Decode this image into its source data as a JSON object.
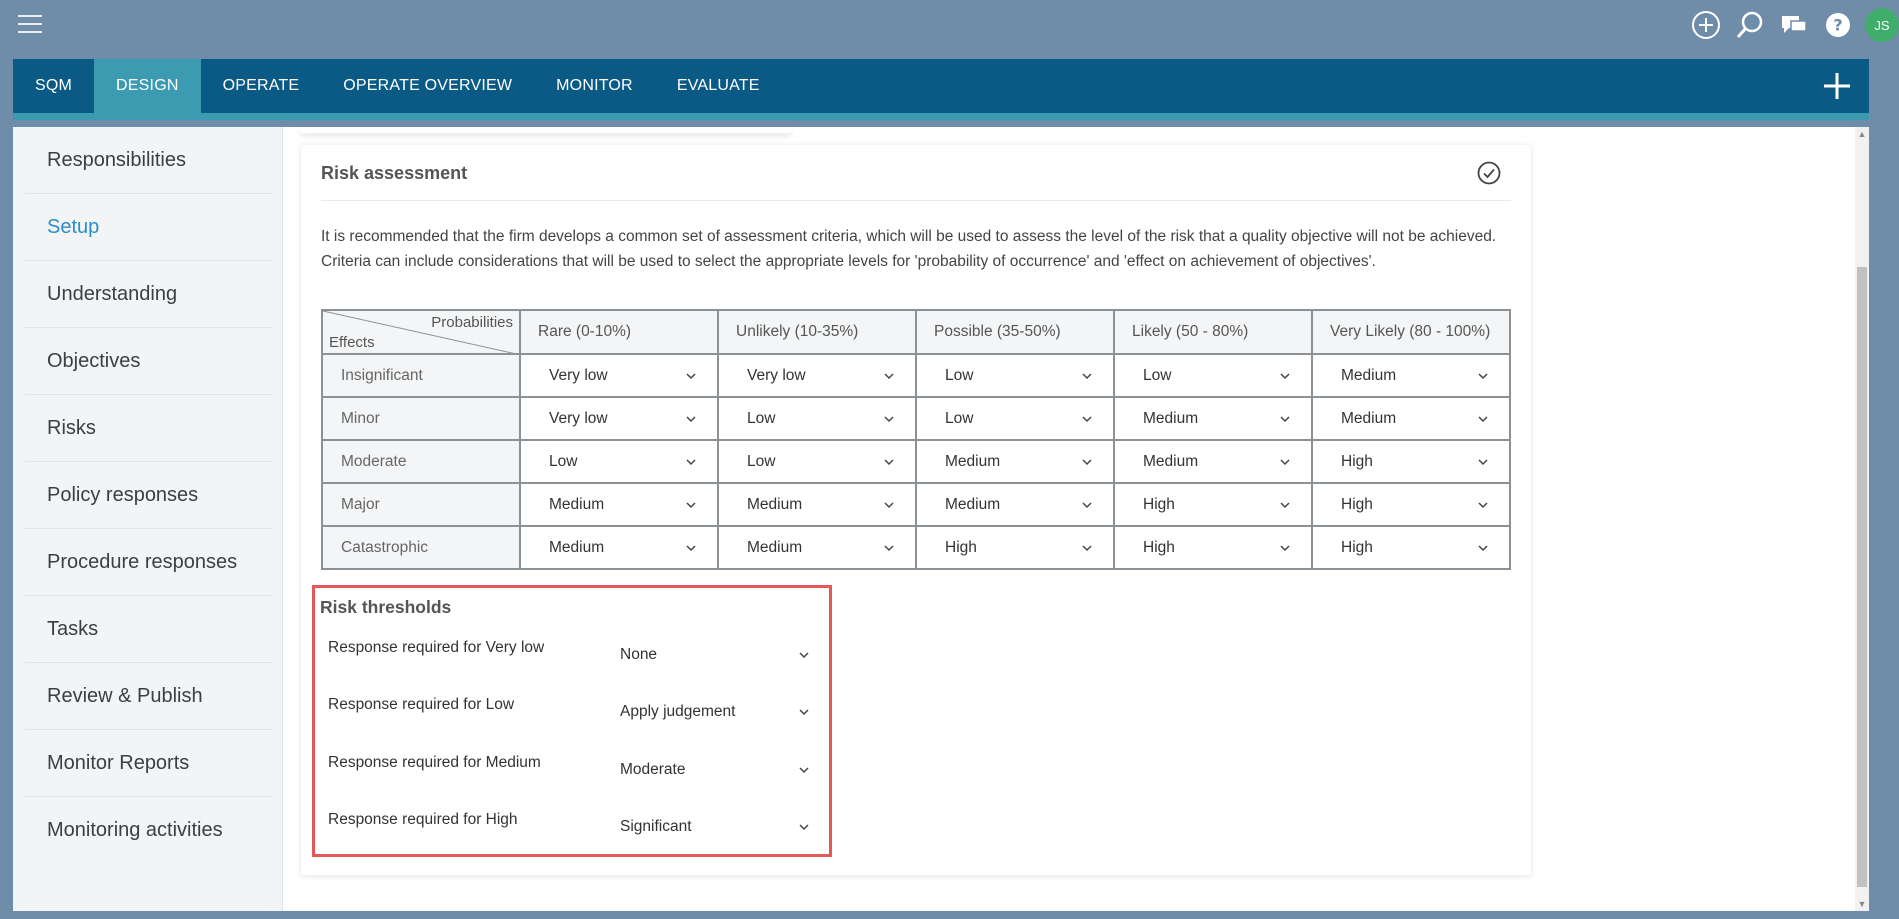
{
  "topbar": {
    "avatar_initials": "JS",
    "icons": [
      "add-circle-icon",
      "search-icon",
      "chat-icon",
      "help-icon"
    ]
  },
  "nav": {
    "tabs": [
      {
        "label": "SQM"
      },
      {
        "label": "DESIGN"
      },
      {
        "label": "OPERATE"
      },
      {
        "label": "OPERATE OVERVIEW"
      },
      {
        "label": "MONITOR"
      },
      {
        "label": "EVALUATE"
      }
    ],
    "active_index": 1
  },
  "sidebar": {
    "items": [
      {
        "label": "Responsibilities"
      },
      {
        "label": "Setup"
      },
      {
        "label": "Understanding"
      },
      {
        "label": "Objectives"
      },
      {
        "label": "Risks"
      },
      {
        "label": "Policy responses"
      },
      {
        "label": "Procedure responses"
      },
      {
        "label": "Tasks"
      },
      {
        "label": "Review & Publish"
      },
      {
        "label": "Monitor Reports"
      },
      {
        "label": "Monitoring activities"
      }
    ],
    "active_index": 1
  },
  "card": {
    "title": "Risk assessment",
    "description_line1": "It is recommended that the firm develops a common set of assessment criteria, which will be used to assess the level of the risk that a quality objective will not be achieved.",
    "description_line2": "Criteria can include considerations that will be used to select the appropriate levels for 'probability of occurrence' and 'effect on achievement of objectives'."
  },
  "matrix": {
    "corner_top": "Probabilities",
    "corner_bottom": "Effects",
    "columns": [
      "Rare (0-10%)",
      "Unlikely (10-35%)",
      "Possible (35-50%)",
      "Likely (50 - 80%)",
      "Very Likely (80 - 100%)"
    ],
    "rows": [
      {
        "effect": "Insignificant",
        "values": [
          "Very low",
          "Very low",
          "Low",
          "Low",
          "Medium"
        ]
      },
      {
        "effect": "Minor",
        "values": [
          "Very low",
          "Low",
          "Low",
          "Medium",
          "Medium"
        ]
      },
      {
        "effect": "Moderate",
        "values": [
          "Low",
          "Low",
          "Medium",
          "Medium",
          "High"
        ]
      },
      {
        "effect": "Major",
        "values": [
          "Medium",
          "Medium",
          "Medium",
          "High",
          "High"
        ]
      },
      {
        "effect": "Catastrophic",
        "values": [
          "Medium",
          "Medium",
          "High",
          "High",
          "High"
        ]
      }
    ]
  },
  "thresholds": {
    "title": "Risk thresholds",
    "items": [
      {
        "label": "Response required for Very low",
        "value": "None"
      },
      {
        "label": "Response required for Low",
        "value": "Apply judgement"
      },
      {
        "label": "Response required for Medium",
        "value": "Moderate"
      },
      {
        "label": "Response required for High",
        "value": "Significant"
      }
    ],
    "highlight_color": "#e5585a"
  },
  "colors": {
    "nav_bg": "#0b5a85",
    "nav_active": "#3c9bb1",
    "sidebar_active": "#2a8fc4",
    "avatar_bg": "#3fae6b"
  }
}
